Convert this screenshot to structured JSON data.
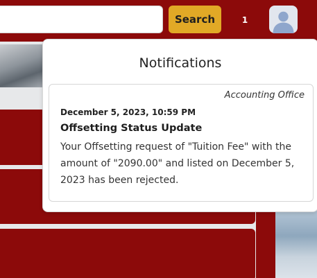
{
  "header": {
    "search": {
      "value": "",
      "placeholder": ""
    },
    "search_button_label": "Search",
    "notification_count": "1",
    "avatar_icon": "user-icon"
  },
  "notifications": {
    "title": "Notifications",
    "items": [
      {
        "source": "Accounting Office",
        "datetime": "December 5, 2023, 10:59 PM",
        "subject": "Offsetting Status Update",
        "body": "Your Offsetting request of \"Tuition Fee\" with the amount of \"2090.00\" and listed on December 5, 2023 has been rejected."
      }
    ]
  },
  "colors": {
    "primary_maroon": "#8c0a0a",
    "accent_gold": "#e1a926",
    "page_background": "#e7e8ea"
  }
}
